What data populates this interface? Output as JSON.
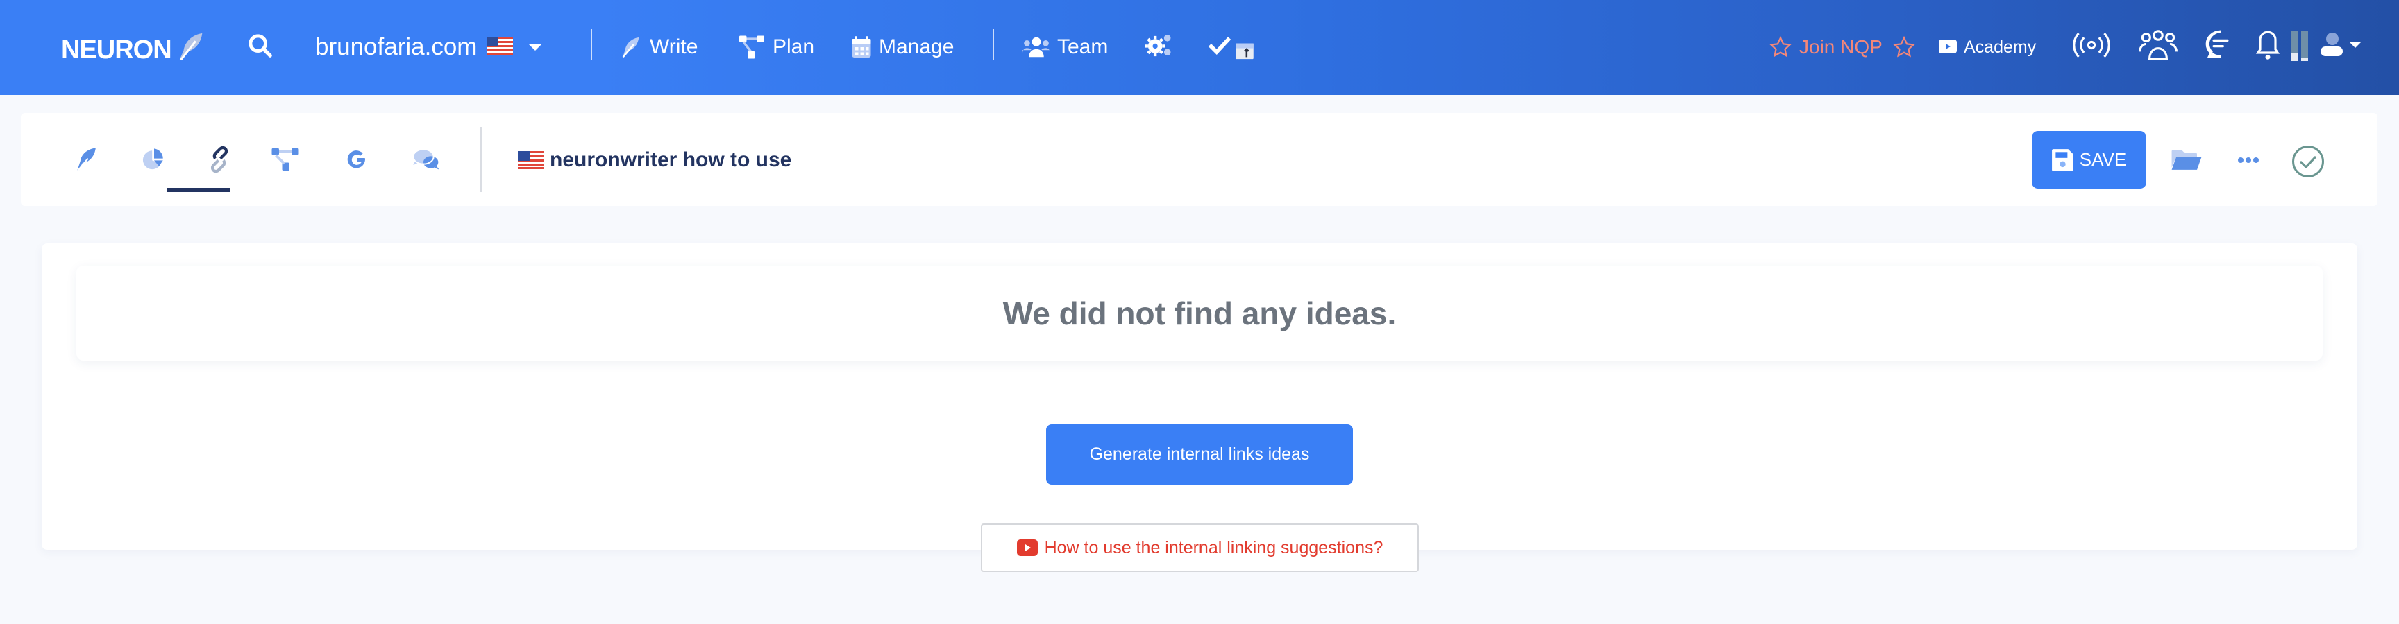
{
  "header": {
    "logo_text": "NEURON",
    "site": "brunofaria.com",
    "nav": [
      {
        "label": "Write",
        "icon": "feather-icon"
      },
      {
        "label": "Plan",
        "icon": "sitemap-icon"
      },
      {
        "label": "Manage",
        "icon": "calendar-icon"
      },
      {
        "label": "Team",
        "icon": "users-icon"
      }
    ],
    "join_label": "Join NQP",
    "academy_label": "Academy",
    "right_icons": [
      "broadcast-icon",
      "group-icon",
      "chat-icon",
      "bell-icon",
      "usage-bars-icon",
      "user-icon"
    ]
  },
  "toolbar": {
    "tabs": [
      {
        "name": "editor",
        "icon": "feather-icon"
      },
      {
        "name": "stats",
        "icon": "pie-chart-icon"
      },
      {
        "name": "internal-links",
        "icon": "link-icon",
        "active": true
      },
      {
        "name": "structure",
        "icon": "sitemap-icon"
      },
      {
        "name": "google",
        "icon": "google-icon"
      },
      {
        "name": "comments",
        "icon": "comments-icon"
      }
    ],
    "document_title": "neuronwriter how to use",
    "save_label": "SAVE"
  },
  "main": {
    "empty_message": "We did not find any ideas.",
    "generate_label": "Generate internal links ideas",
    "help_label": "How to use the internal linking suggestions?"
  },
  "colors": {
    "accent": "#3a7ff5",
    "navy": "#233461",
    "join": "#f2877a",
    "help_red": "#e23b2e",
    "check_green": "#6a9690"
  }
}
